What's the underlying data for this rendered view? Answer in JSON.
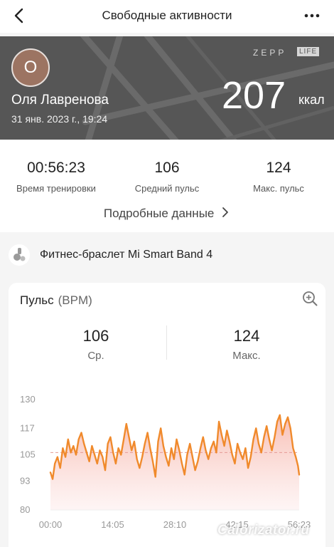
{
  "header": {
    "title": "Свободные активности",
    "back_icon": "chevron-left-icon",
    "menu_icon": "more-dots-icon"
  },
  "hero": {
    "avatar_letter": "О",
    "brand_part1": "ZEPP",
    "brand_part2": "LIFE",
    "user_name": "Оля Лавренова",
    "date": "31 янв. 2023 г., 19:24",
    "calories": "207",
    "calories_unit": "ккал"
  },
  "summary": {
    "stats": [
      {
        "value": "00:56:23",
        "label": "Время тренировки"
      },
      {
        "value": "106",
        "label": "Средний пульс"
      },
      {
        "value": "124",
        "label": "Макс. пульс"
      }
    ],
    "details_link": "Подробные данные"
  },
  "device": {
    "name": "Фитнес-браслет Mi Smart Band 4"
  },
  "heart_card": {
    "title": "Пульс",
    "unit": "(BPM)",
    "avg_value": "106",
    "avg_label": "Ср.",
    "max_value": "124",
    "max_label": "Макс."
  },
  "colors": {
    "line": "#f08a2c",
    "fill_top": "#f7b7ab",
    "fill_bottom": "#fdeeee",
    "avg_line": "#e59b94"
  },
  "chart_data": {
    "type": "area",
    "ylim": [
      80,
      130
    ],
    "yticks": [
      "130",
      "117",
      "105",
      "93",
      "80"
    ],
    "ytick_values": [
      130,
      117,
      105,
      93,
      80
    ],
    "xticks": [
      "00:00",
      "14:05",
      "28:10",
      "42:15",
      "56:23"
    ],
    "xlim_minutes": [
      0,
      56.38
    ],
    "average": 106,
    "x_minutes": [
      0,
      0.5,
      1,
      1.6,
      2.2,
      2.8,
      3.4,
      4,
      4.6,
      5.2,
      5.8,
      6.4,
      7,
      7.6,
      8.2,
      8.8,
      9.4,
      10,
      10.6,
      11.2,
      11.8,
      12.4,
      13,
      13.6,
      14.2,
      14.8,
      15.4,
      16,
      16.6,
      17.2,
      17.8,
      18.4,
      19,
      19.6,
      20.2,
      20.8,
      21.4,
      22,
      22.6,
      23.2,
      23.8,
      24.4,
      25,
      25.6,
      26.2,
      26.8,
      27.4,
      28,
      28.6,
      29.2,
      29.8,
      30.4,
      31,
      31.6,
      32.2,
      32.8,
      33.4,
      34,
      34.6,
      35.2,
      35.8,
      36.4,
      37,
      37.6,
      38.2,
      38.8,
      39.4,
      40,
      40.6,
      41.2,
      41.8,
      42.4,
      43,
      43.6,
      44.2,
      44.8,
      45.4,
      46,
      46.6,
      47.2,
      47.8,
      48.4,
      49,
      49.6,
      50.2,
      50.8,
      51.4,
      52,
      52.6,
      53.2,
      53.8,
      54.4,
      55,
      55.6,
      56.1,
      56.38
    ],
    "values": [
      97,
      94,
      101,
      104,
      99,
      108,
      104,
      112,
      106,
      109,
      105,
      112,
      115,
      110,
      106,
      102,
      109,
      105,
      101,
      107,
      104,
      98,
      110,
      113,
      106,
      101,
      108,
      105,
      112,
      119,
      113,
      107,
      111,
      103,
      99,
      104,
      110,
      115,
      108,
      102,
      95,
      111,
      117,
      109,
      104,
      100,
      108,
      103,
      112,
      107,
      101,
      96,
      105,
      110,
      104,
      98,
      102,
      108,
      113,
      107,
      103,
      108,
      111,
      106,
      120,
      114,
      109,
      116,
      111,
      105,
      101,
      110,
      106,
      103,
      108,
      99,
      104,
      112,
      117,
      110,
      106,
      113,
      118,
      112,
      107,
      113,
      120,
      123,
      114,
      119,
      122,
      117,
      108,
      104,
      100,
      96,
      95
    ]
  }
}
